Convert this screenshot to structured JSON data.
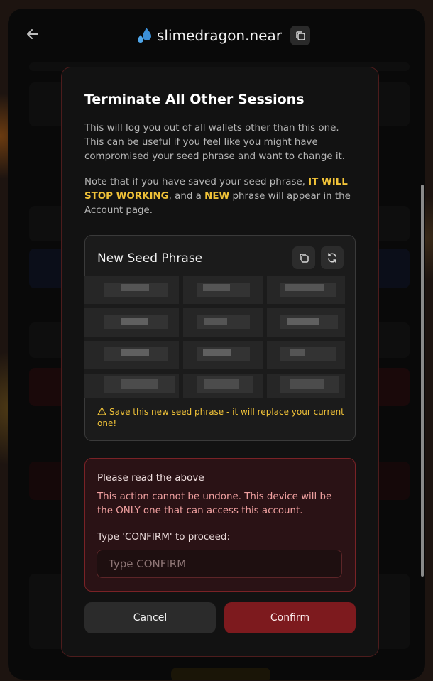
{
  "header": {
    "account_name": "slimedragon.near"
  },
  "modal": {
    "title": "Terminate All Other Sessions",
    "paragraph1": "This will log you out of all wallets other than this one. This can be useful if you feel like you might have compromised your seed phrase and want to change it.",
    "paragraph2": {
      "pre": "Note that if you have saved your seed phrase, ",
      "emph1": "IT WILL STOP WORKING",
      "mid": ", and a ",
      "emph2": "NEW",
      "post": " phrase will appear in the Account page."
    },
    "seed_card": {
      "title": "New Seed Phrase",
      "warning": "Save this new seed phrase - it will replace your current one!"
    },
    "danger_box": {
      "title": "Please read the above",
      "text": "This action cannot be undone. This device will be the ONLY one that can access this account.",
      "input_label": "Type 'CONFIRM' to proceed:",
      "input_placeholder": "Type CONFIRM",
      "input_value": ""
    },
    "buttons": {
      "cancel": "Cancel",
      "confirm": "Confirm"
    }
  },
  "colors": {
    "accent_warning": "#f0c238",
    "danger": "#7d1a1e"
  }
}
